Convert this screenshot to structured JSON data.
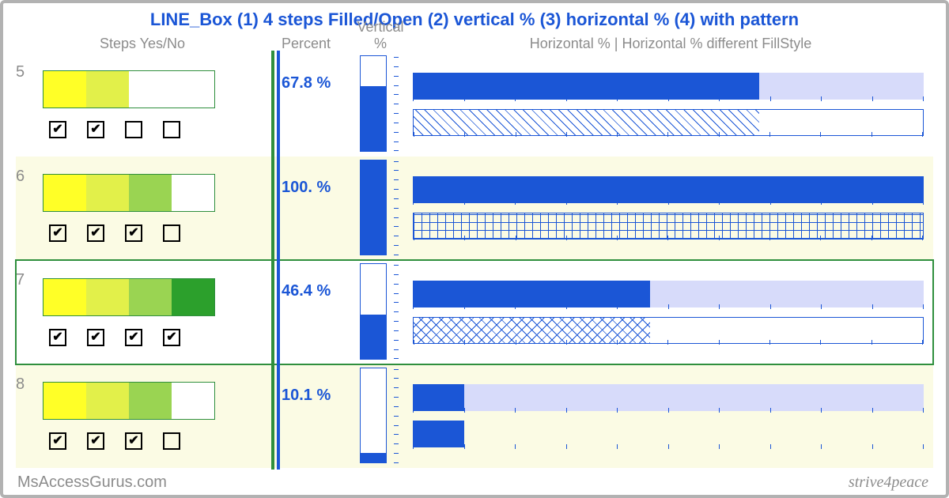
{
  "title": "LINE_Box (1) 4 steps Filled/Open (2) vertical % (3) horizontal % (4) with pattern",
  "headers": {
    "steps": "Steps Yes/No",
    "percent": "Percent",
    "vertical": "Vertical %",
    "horizontal": "Horizontal %  |  Horizontal % different FillStyle"
  },
  "step_colors": [
    "#ffff27",
    "#e2f04a",
    "#9ad452",
    "#2ca02c"
  ],
  "accent": "#1b56d6",
  "frame_green": "#2f8f3d",
  "footer_left": "MsAccessGurus.com",
  "footer_right": "strive4peace",
  "chart_data": {
    "type": "table",
    "columns": [
      "id",
      "steps_filled",
      "percent",
      "percent_label",
      "pattern",
      "highlighted"
    ],
    "rows": [
      {
        "id": 5,
        "steps_filled": 2,
        "percent": 67.8,
        "percent_label": "67.8 %",
        "pattern": "diag",
        "highlighted": false
      },
      {
        "id": 6,
        "steps_filled": 3,
        "percent": 100.0,
        "percent_label": "100. %",
        "pattern": "grid",
        "highlighted": false
      },
      {
        "id": 7,
        "steps_filled": 4,
        "percent": 46.4,
        "percent_label": "46.4 %",
        "pattern": "cross",
        "highlighted": true
      },
      {
        "id": 8,
        "steps_filled": 3,
        "percent": 10.1,
        "percent_label": "10.1 %",
        "pattern": "solid",
        "highlighted": false
      }
    ],
    "xlim": [
      0,
      100
    ],
    "ylim": [
      0,
      100
    ]
  }
}
